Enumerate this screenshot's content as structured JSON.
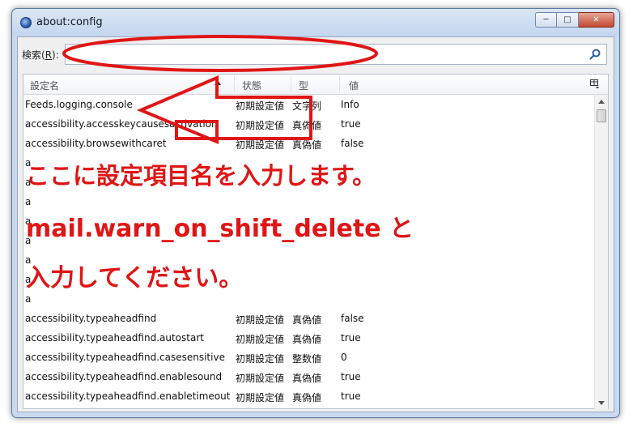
{
  "window": {
    "title": "about:config",
    "minimize_glyph": "─",
    "maximize_glyph": "□",
    "close_glyph": "✕"
  },
  "search": {
    "label": "検索(",
    "label_accel": "R",
    "label_suffix": "):",
    "value": ""
  },
  "table": {
    "columns": [
      "設定名",
      "状態",
      "型",
      "値"
    ],
    "rows": [
      {
        "name": "Feeds.logging.console",
        "status": "初期設定値",
        "type": "文字列",
        "value": "Info"
      },
      {
        "name": "accessibility.accesskeycausesactivation",
        "status": "初期設定値",
        "type": "真偽値",
        "value": "true"
      },
      {
        "name": "accessibility.browsewithcaret",
        "status": "初期設定値",
        "type": "真偽値",
        "value": "false"
      },
      {
        "name": "a",
        "status": "",
        "type": "",
        "value": ""
      },
      {
        "name": "a",
        "status": "",
        "type": "",
        "value": ""
      },
      {
        "name": "a",
        "status": "",
        "type": "",
        "value": ""
      },
      {
        "name": "a",
        "status": "",
        "type": "",
        "value": ""
      },
      {
        "name": "a",
        "status": "",
        "type": "",
        "value": ""
      },
      {
        "name": "a",
        "status": "",
        "type": "",
        "value": ""
      },
      {
        "name": "a",
        "status": "",
        "type": "",
        "value": ""
      },
      {
        "name": "a",
        "status": "",
        "type": "",
        "value": ""
      },
      {
        "name": "accessibility.typeaheadfind",
        "status": "初期設定値",
        "type": "真偽値",
        "value": "false"
      },
      {
        "name": "accessibility.typeaheadfind.autostart",
        "status": "初期設定値",
        "type": "真偽値",
        "value": "true"
      },
      {
        "name": "accessibility.typeaheadfind.casesensitive",
        "status": "初期設定値",
        "type": "整数値",
        "value": "0"
      },
      {
        "name": "accessibility.typeaheadfind.enablesound",
        "status": "初期設定値",
        "type": "真偽値",
        "value": "true"
      },
      {
        "name": "accessibility.typeaheadfind.enabletimeout",
        "status": "初期設定値",
        "type": "真偽値",
        "value": "true"
      }
    ]
  },
  "annotation": {
    "line1": "ここに設定項目名を入力します。",
    "line2": "mail.warn_on_shift_delete と",
    "line3": "入力してください。",
    "color": "#e01515"
  }
}
